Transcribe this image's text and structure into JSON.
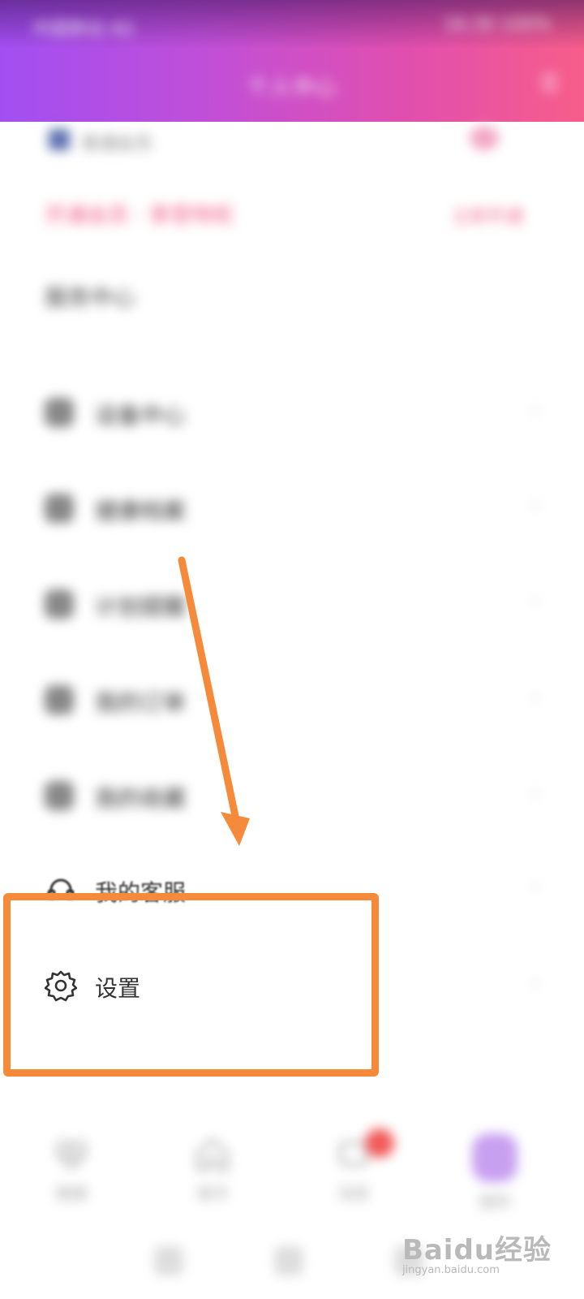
{
  "status_bar": {
    "left": "中国移动 4G",
    "right": "16:30 100%"
  },
  "header": {
    "title": "个人中心"
  },
  "account": {
    "text": "普通会员"
  },
  "promo": {
    "text": "开通会员 · 享受特权",
    "more": "立即开通"
  },
  "section_title": "服务中心",
  "menu": {
    "items": [
      {
        "label": "设备中心",
        "icon": "device-icon"
      },
      {
        "label": "健康档案",
        "icon": "profile-icon"
      },
      {
        "label": "计划提醒",
        "icon": "calendar-icon"
      },
      {
        "label": "我的订单",
        "icon": "order-icon"
      },
      {
        "label": "我的收藏",
        "icon": "star-icon"
      },
      {
        "label": "我的客服",
        "icon": "headset-icon"
      },
      {
        "label": "设置",
        "icon": "gear-icon"
      }
    ],
    "chevron": "›"
  },
  "tabbar": {
    "items": [
      {
        "label": "健康",
        "icon": "heart-pulse-icon"
      },
      {
        "label": "首页",
        "icon": "home-icon"
      },
      {
        "label": "消息",
        "icon": "message-icon"
      },
      {
        "label": "我的",
        "icon": "profile-icon"
      }
    ]
  },
  "watermark": {
    "main": "Baidu经验",
    "sub": "jingyan.baidu.com"
  },
  "colors": {
    "header_gradient": [
      "#a24ff2",
      "#f75d8a"
    ],
    "highlight": "#f58a3a",
    "accent_pink": "#f05a82"
  }
}
